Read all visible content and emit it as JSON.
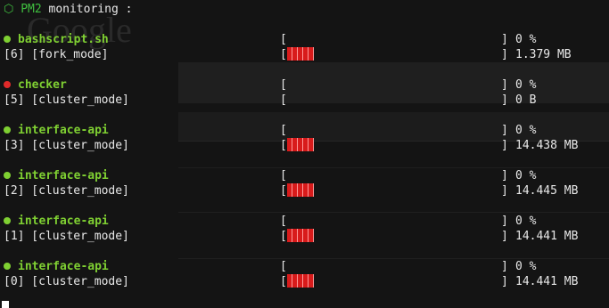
{
  "header": {
    "icon": "⬡",
    "app": "PM2",
    "text": " monitoring :"
  },
  "colors": {
    "online": "#7fd032",
    "stopped": "#e02a2a",
    "meter": "#d81b1b"
  },
  "processes": [
    {
      "name": "bashscript.sh",
      "status": "online",
      "id_mode": "[6] [fork_mode]",
      "cpu": "0 %",
      "mem": "1.379 MB",
      "mem_blocks": 5
    },
    {
      "name": "checker",
      "status": "stopped",
      "id_mode": "[5] [cluster_mode]",
      "cpu": "0 %",
      "mem": "0 B",
      "mem_blocks": 0
    },
    {
      "name": "interface-api",
      "status": "online",
      "id_mode": "[3] [cluster_mode]",
      "cpu": "0 %",
      "mem": "14.438 MB",
      "mem_blocks": 5
    },
    {
      "name": "interface-api",
      "status": "online",
      "id_mode": "[2] [cluster_mode]",
      "cpu": "0 %",
      "mem": "14.445 MB",
      "mem_blocks": 5
    },
    {
      "name": "interface-api",
      "status": "online",
      "id_mode": "[1] [cluster_mode]",
      "cpu": "0 %",
      "mem": "14.441 MB",
      "mem_blocks": 5
    },
    {
      "name": "interface-api",
      "status": "online",
      "id_mode": "[0] [cluster_mode]",
      "cpu": "0 %",
      "mem": "14.441 MB",
      "mem_blocks": 5
    }
  ],
  "bracket_open": "[",
  "bracket_close": "]"
}
